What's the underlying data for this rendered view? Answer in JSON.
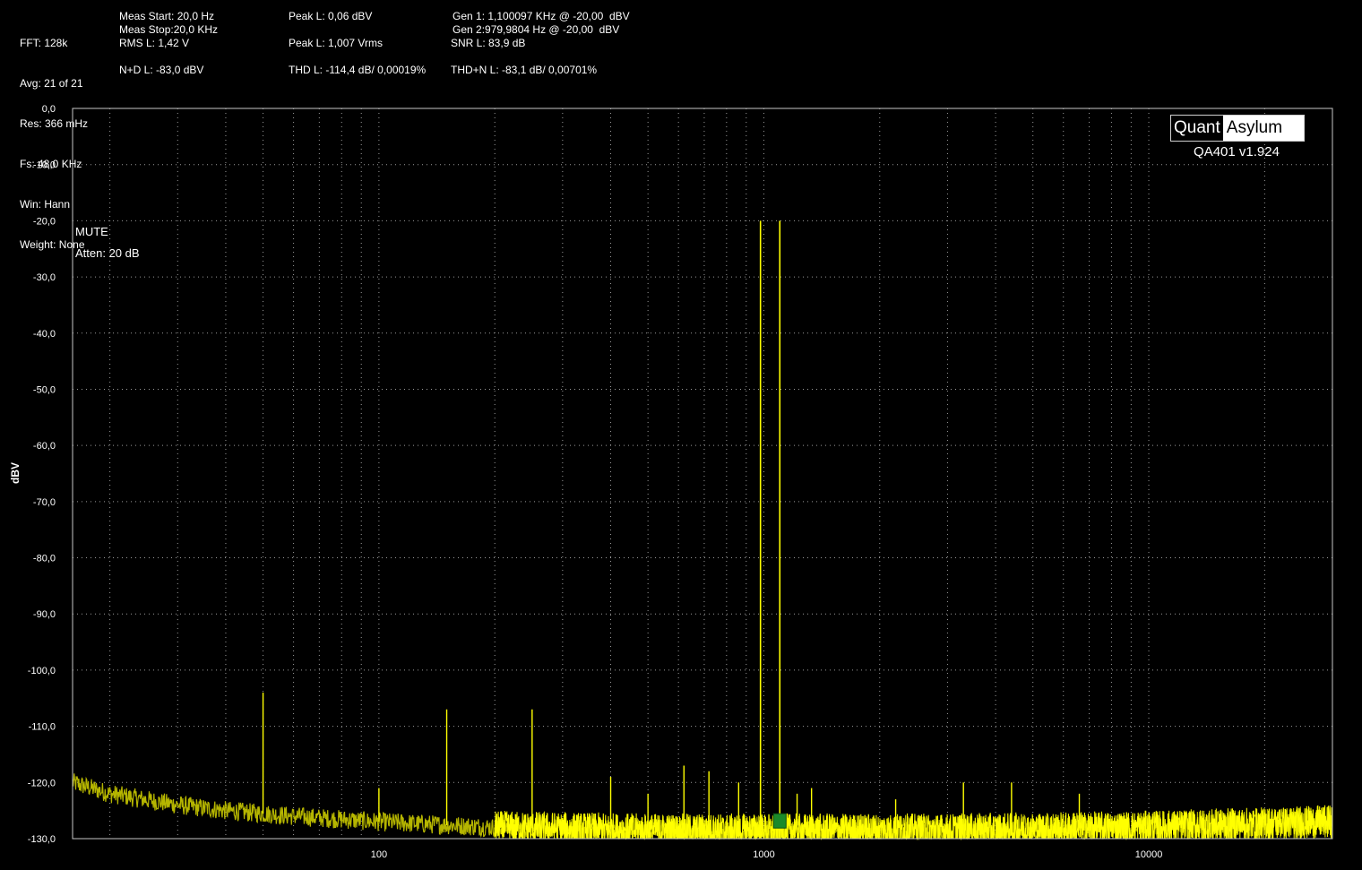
{
  "header": {
    "col1": [
      "FFT: 128k",
      "Avg: 21 of 21",
      "Res: 366 mHz",
      "Fs: 48,0 KHz",
      "Win: Hann",
      "Weight: None"
    ],
    "meas_start": "Meas Start: 20,0 Hz",
    "meas_stop": "Meas Stop:20,0 KHz",
    "rms": "RMS L: 1,42 V",
    "nd": "N+D L: -83,0 dBV",
    "peak_dbv": "Peak L: 0,06 dBV",
    "peak_vrms": "Peak L: 1,007 Vrms",
    "thd": "THD L: -114,4 dB/ 0,00019%",
    "gen1": "Gen 1: 1,100097 KHz @ -20,00  dBV",
    "gen2": "Gen 2:979,9804 Hz @ -20,00  dBV",
    "snr": "SNR L: 83,9 dB",
    "thdn": "THD+N L: -83,1 dB/ 0,00701%"
  },
  "notes": {
    "mute": "MUTE",
    "atten": "Atten: 20 dB"
  },
  "logo": {
    "quant": "Quant",
    "asylum": "Asylum",
    "version": "QA401 v1.924"
  },
  "colors": {
    "trace": "#ffff00",
    "grid": "#9a9a9a",
    "background": "#000000",
    "marker": "#1a8a2a",
    "trace_dim": "#b5b500"
  },
  "chart_data": {
    "type": "line",
    "title": "",
    "xlabel": "",
    "ylabel": "dBV",
    "x_scale": "log",
    "xlim": [
      16,
      30000
    ],
    "ylim": [
      -130,
      0
    ],
    "y_ticks": [
      "0,0",
      "-10,0",
      "-20,0",
      "-30,0",
      "-40,0",
      "-50,0",
      "-60,0",
      "-70,0",
      "-80,0",
      "-90,0",
      "-100,0",
      "-110,0",
      "-120,0",
      "-130,0"
    ],
    "x_ticks": [
      {
        "value": 100,
        "label": "100"
      },
      {
        "value": 1000,
        "label": "1000"
      },
      {
        "value": 10000,
        "label": "10000"
      }
    ],
    "grid": true,
    "series": [
      {
        "noise_floor": [
          [
            16,
            -120
          ],
          [
            20,
            -122
          ],
          [
            30,
            -124
          ],
          [
            40,
            -125
          ],
          [
            60,
            -126
          ],
          [
            100,
            -127
          ],
          [
            200,
            -128
          ],
          [
            500,
            -128.5
          ],
          [
            1000,
            -128.5
          ],
          [
            3000,
            -128.5
          ],
          [
            10000,
            -128
          ],
          [
            30000,
            -127
          ]
        ],
        "peaks": [
          {
            "freq": 50,
            "level": -104
          },
          {
            "freq": 100,
            "level": -121
          },
          {
            "freq": 150,
            "level": -107
          },
          {
            "freq": 250,
            "level": -107
          },
          {
            "freq": 400,
            "level": -119
          },
          {
            "freq": 500,
            "level": -122
          },
          {
            "freq": 620,
            "level": -117
          },
          {
            "freq": 720,
            "level": -118
          },
          {
            "freq": 860,
            "level": -120
          },
          {
            "freq": 979.98,
            "level": -20
          },
          {
            "freq": 1100.1,
            "level": -20
          },
          {
            "freq": 1220,
            "level": -122
          },
          {
            "freq": 1330,
            "level": -121
          },
          {
            "freq": 2200,
            "level": -123
          },
          {
            "freq": 3300,
            "level": -120
          },
          {
            "freq": 4400,
            "level": -120
          },
          {
            "freq": 6600,
            "level": -122
          }
        ]
      }
    ],
    "marker": {
      "freq": 1100,
      "level": -127
    }
  }
}
